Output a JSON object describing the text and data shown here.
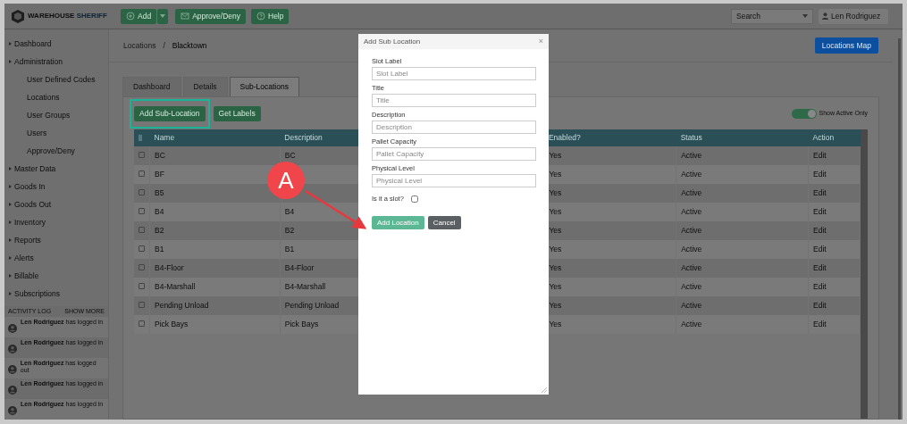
{
  "header": {
    "logo": {
      "word": "WAREHOUSE",
      "accent": "SHERIFF"
    },
    "buttons": [
      {
        "label": "Add",
        "has_menu": true
      },
      {
        "label": "Approve/Deny",
        "has_menu": false
      },
      {
        "label": "Help",
        "has_menu": false
      }
    ],
    "search": {
      "value": "Search"
    },
    "user": {
      "name": "Len Rodriguez"
    }
  },
  "sidebar": {
    "items": [
      {
        "label": "Dashboard"
      },
      {
        "label": "Administration",
        "children": [
          {
            "label": "User Defined Codes"
          },
          {
            "label": "Locations"
          },
          {
            "label": "User Groups"
          },
          {
            "label": "Users"
          },
          {
            "label": "Approve/Deny"
          }
        ]
      },
      {
        "label": "Master Data"
      },
      {
        "label": "Goods In"
      },
      {
        "label": "Goods Out"
      },
      {
        "label": "Inventory"
      },
      {
        "label": "Reports"
      },
      {
        "label": "Alerts"
      },
      {
        "label": "Billable"
      },
      {
        "label": "Subscriptions"
      }
    ]
  },
  "activity_log": {
    "title": "ACTIVITY LOG",
    "action": "SHOW MORE",
    "entries": [
      "**Len Rodriguez** has logged in",
      "**Len Rodriguez** has logged in",
      "**Len Rodriguez** has logged out",
      "**Len Rodriguez** has logged in",
      "**Len Rodriguez** has logged in"
    ]
  },
  "breadcrumb": {
    "items": [
      "Locations",
      "Blacktown"
    ],
    "separator": "/"
  },
  "locations_map_button": "Locations Map",
  "tabs": [
    {
      "label": "Dashboard",
      "selected": false
    },
    {
      "label": "Details",
      "selected": false
    },
    {
      "label": "Sub-Locations",
      "selected": true
    }
  ],
  "toolbar": {
    "buttons": [
      {
        "label": "Add Sub-Location",
        "highlighted": true
      },
      {
        "label": "Get Labels",
        "highlighted": false
      }
    ],
    "toggle": {
      "label": "Show Active Only",
      "on": true
    }
  },
  "table": {
    "columns": [
      "Name",
      "Description",
      "Enabled?",
      "Status",
      "Action"
    ],
    "rows": [
      {
        "checked": false,
        "name": "BC",
        "description": "BC",
        "enabled": "Yes",
        "status": "Active",
        "action": "Edit"
      },
      {
        "checked": false,
        "name": "BF",
        "enabled": "Yes",
        "status": "Active",
        "action": "Edit"
      },
      {
        "checked": false,
        "name": "B5",
        "enabled": "Yes",
        "status": "Active",
        "action": "Edit"
      },
      {
        "checked": false,
        "name": "B4",
        "description": "B4",
        "enabled": "Yes",
        "status": "Active",
        "action": "Edit"
      },
      {
        "checked": false,
        "name": "B2",
        "description": "B2",
        "enabled": "Yes",
        "status": "Active",
        "action": "Edit"
      },
      {
        "checked": false,
        "name": "B1",
        "description": "B1",
        "enabled": "Yes",
        "status": "Active",
        "action": "Edit"
      },
      {
        "checked": false,
        "name": "B4-Floor",
        "description": "B4-Floor",
        "enabled": "Yes",
        "status": "Active",
        "action": "Edit"
      },
      {
        "checked": false,
        "name": "B4-Marshall",
        "description": "B4-Marshall",
        "enabled": "Yes",
        "status": "Active",
        "action": "Edit"
      },
      {
        "checked": false,
        "name": "Pending Unload",
        "description": "Pending Unload",
        "enabled": "Yes",
        "status": "Active",
        "action": "Edit"
      },
      {
        "checked": false,
        "name": "Pick Bays",
        "description": "Pick Bays",
        "enabled": "Yes",
        "status": "Active",
        "action": "Edit"
      }
    ]
  },
  "modal": {
    "title": "Add Sub Location",
    "close": "×",
    "fields": [
      {
        "label": "Slot Label",
        "placeholder": "Slot Label"
      },
      {
        "label": "Title",
        "placeholder": "Title"
      },
      {
        "label": "Description",
        "placeholder": "Description"
      },
      {
        "label": "Pallet Capacity",
        "placeholder": "Pallet Capacity"
      },
      {
        "label": "Physical Level",
        "placeholder": "Physical Level"
      }
    ],
    "slot_checkbox": {
      "label": "Is it a slot?",
      "checked": false
    },
    "buttons": [
      {
        "label": "Add Location",
        "kind": "primary"
      },
      {
        "label": "Cancel",
        "kind": "secondary"
      }
    ]
  },
  "annotation": {
    "label": "A"
  }
}
